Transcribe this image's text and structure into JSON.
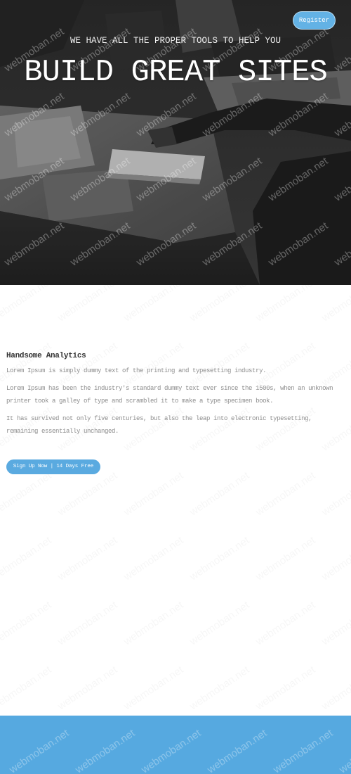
{
  "watermark": {
    "text": "webmoban.net"
  },
  "header": {
    "register_label": "Register"
  },
  "hero": {
    "kicker": "WE HAVE ALL THE PROPER TOOLS TO HELP YOU",
    "title": "BUILD GREAT SITES"
  },
  "features": {
    "heading": "Handsome Analytics",
    "paragraphs": [
      "Lorem Ipsum is simply dummy text of the printing and typesetting industry.",
      "Lorem Ipsum has been the industry's standard dummy text ever since the 1500s, when an unknown printer took a galley of type and scrambled it to make a type specimen book.",
      "It has survived not only five centuries, but also the leap into electronic typesetting, remaining essentially unchanged."
    ]
  },
  "cta": {
    "label": "Sign Up Now | 14 Days Free"
  },
  "colors": {
    "accent": "#5aaae0",
    "hero_background": "#353535",
    "heading_text": "#333333",
    "body_text": "#8c8c8c",
    "footer_background": "#56a9e0"
  }
}
